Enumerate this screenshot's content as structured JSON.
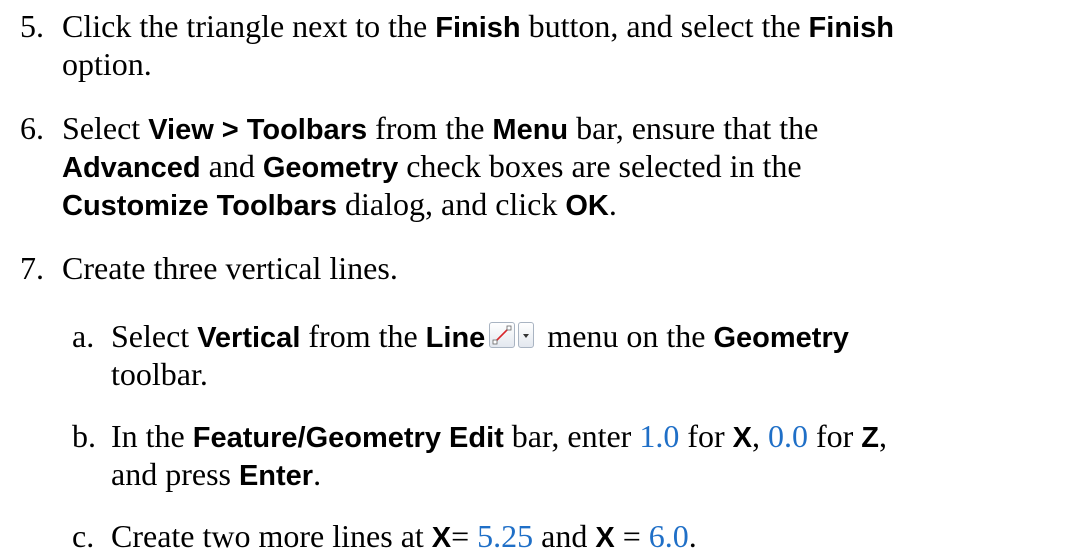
{
  "steps": [
    {
      "num": "5.",
      "line1": [
        "Click the triangle next to the ",
        "Finish",
        " button, and select the ",
        "Finish"
      ],
      "line2": [
        "option."
      ]
    },
    {
      "num": "6.",
      "line1": [
        "Select ",
        "View > Toolbars",
        " from the ",
        "Menu",
        " bar, ensure that the"
      ],
      "line2": [
        "Advanced",
        " and ",
        "Geometry",
        " check boxes are selected in the"
      ],
      "line3": [
        "Customize Toolbars",
        " dialog, and click ",
        "OK",
        "."
      ]
    },
    {
      "num": "7.",
      "line1": [
        "Create three vertical lines."
      ]
    }
  ],
  "substeps": [
    {
      "letter": "a.",
      "line1": [
        "Select ",
        "Vertical",
        " from the ",
        "Line",
        " menu on the ",
        "Geometry"
      ],
      "line2": [
        "toolbar."
      ]
    },
    {
      "letter": "b.",
      "line1": [
        "In the ",
        "Feature/Geometry Edit",
        " bar, enter ",
        "1.0",
        " for ",
        "X",
        ", ",
        "0.0",
        " for ",
        "Z",
        ","
      ],
      "line2": [
        "and press ",
        "Enter",
        "."
      ]
    },
    {
      "letter": "c.",
      "line1": [
        "Create two more lines at ",
        "X",
        "= ",
        "5.25",
        " and ",
        "X",
        " = ",
        "6.0",
        "."
      ]
    }
  ],
  "icons": {
    "line_tool": "line-tool-icon",
    "dropdown": "dropdown-arrow-icon"
  },
  "colors": {
    "value": "#1f6fc7",
    "line_icon": "#d9262a"
  }
}
